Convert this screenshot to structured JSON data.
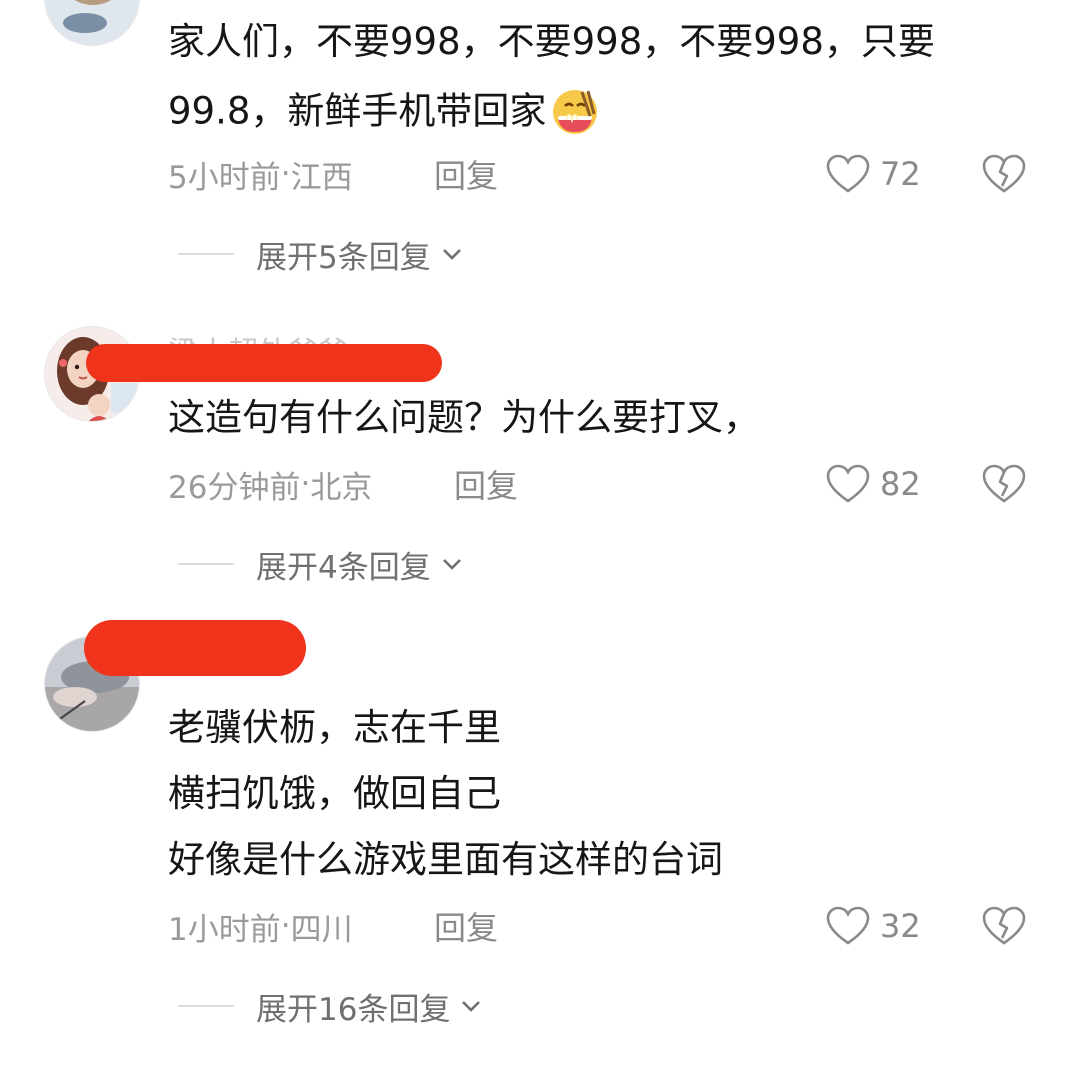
{
  "comments": [
    {
      "text_lines": [
        "家人们，不要998，不要998，不要998，只要",
        "99.8，新鲜手机带回家"
      ],
      "emoji": "eating-noodles-emoji",
      "time": "5小时前",
      "location": "江西",
      "meta_sep": " · ",
      "reply_label": "回复",
      "likes": "72",
      "expand_label": "展开5条回复"
    },
    {
      "username_partial": "梁大超外爸爸",
      "text_lines": [
        "这造句有什么问题？为什么要打叉，"
      ],
      "time": "26分钟前",
      "location": "北京",
      "meta_sep": " · ",
      "reply_label": "回复",
      "likes": "82",
      "expand_label": "展开4条回复"
    },
    {
      "text_lines": [
        "老骥伏枥，志在千里",
        "横扫饥饿，做回自己",
        "好像是什么游戏里面有这样的台词"
      ],
      "time": "1小时前",
      "location": "四川",
      "meta_sep": " · ",
      "reply_label": "回复",
      "likes": "32",
      "expand_label": "展开16条回复"
    }
  ],
  "icons": {
    "like": "heart-outline-icon",
    "dislike": "broken-heart-icon",
    "expand": "chevron-down-icon"
  },
  "colors": {
    "redaction": "#f0341b",
    "meta_text": "#9a9a9a",
    "body_text": "#161616"
  }
}
